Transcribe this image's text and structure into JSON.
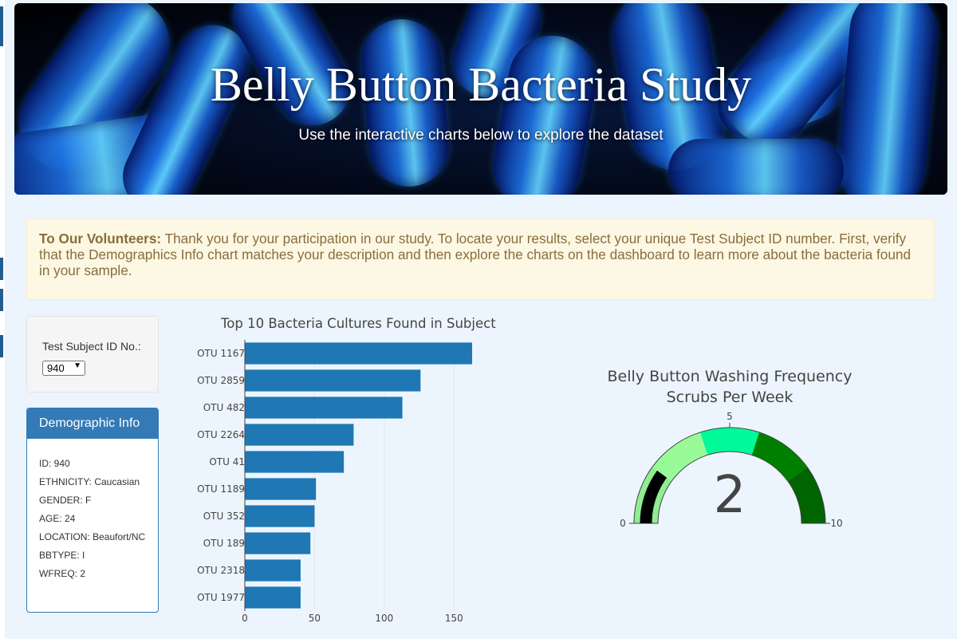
{
  "banner": {
    "title": "Belly Button Bacteria Study",
    "subtitle": "Use the interactive charts below to explore the dataset"
  },
  "alert": {
    "lead": "To Our Volunteers:",
    "text": " Thank you for your participation in our study. To locate your results, select your unique Test Subject ID number. First, verify that the Demographics Info chart matches your description and then explore the charts on the dashboard to learn more about the bacteria found in your sample."
  },
  "selector": {
    "label": "Test Subject ID No.:",
    "selected": "940"
  },
  "demographics": {
    "title": "Demographic Info",
    "rows": [
      "ID: 940",
      "ETHNICITY: Caucasian",
      "GENDER: F",
      "AGE: 24",
      "LOCATION: Beaufort/NC",
      "BBTYPE: I",
      "WFREQ: 2"
    ]
  },
  "chart_data": [
    {
      "type": "bar",
      "orientation": "horizontal",
      "title": "Top 10 Bacteria Cultures Found in Subject",
      "categories": [
        "OTU 1167",
        "OTU 2859",
        "OTU 482",
        "OTU 2264",
        "OTU 41",
        "OTU 1189",
        "OTU 352",
        "OTU 189",
        "OTU 2318",
        "OTU 1977"
      ],
      "values": [
        163,
        126,
        113,
        78,
        71,
        51,
        50,
        47,
        40,
        40
      ],
      "xticks": [
        0,
        50,
        100,
        150
      ],
      "xlim": [
        0,
        167
      ],
      "grid": true,
      "color": "#1f77b4"
    },
    {
      "type": "gauge",
      "title": "Belly Button Washing Frequency",
      "subtitle": "Scrubs Per Week",
      "value": 2,
      "range": [
        0,
        10
      ],
      "ticks": [
        0,
        5,
        10
      ],
      "bar_color": "#000000",
      "steps": [
        {
          "range": [
            0,
            2
          ],
          "color": "#90ee90"
        },
        {
          "range": [
            2,
            4
          ],
          "color": "#98fb98"
        },
        {
          "range": [
            4,
            6
          ],
          "color": "#00fa9a"
        },
        {
          "range": [
            6,
            8
          ],
          "color": "#008000"
        },
        {
          "range": [
            8,
            10
          ],
          "color": "#006400"
        }
      ]
    }
  ]
}
